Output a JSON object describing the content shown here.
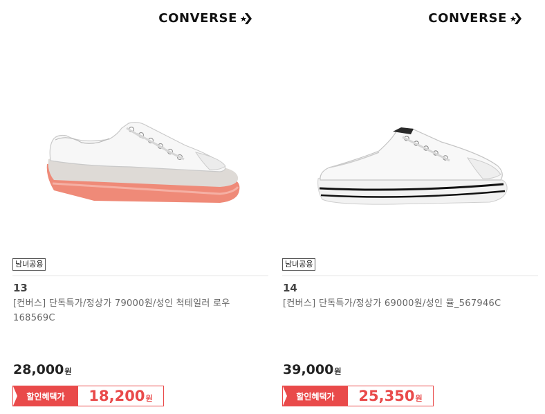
{
  "products": [
    {
      "brand": "CONVERSE",
      "tag": "남녀공용",
      "number": "13",
      "title": "[컨버스] 단독특가/정상가 79000원/성인 척테일러 로우 168569C",
      "price": "28,000",
      "currency": "원",
      "benefit_label": "할인혜택가",
      "discount_price": "18,200",
      "image_icon": "white-low-top-sneaker-coral-sole"
    },
    {
      "brand": "CONVERSE",
      "tag": "남녀공용",
      "number": "14",
      "title": "[컨버스] 단독특가/정상가 69000원/성인 뮬_567946C",
      "price": "39,000",
      "currency": "원",
      "benefit_label": "할인혜택가",
      "discount_price": "25,350",
      "image_icon": "white-mule-sneaker-black-stripe"
    }
  ],
  "colors": {
    "accent": "#e94a4a",
    "brand_text": "#111111"
  }
}
